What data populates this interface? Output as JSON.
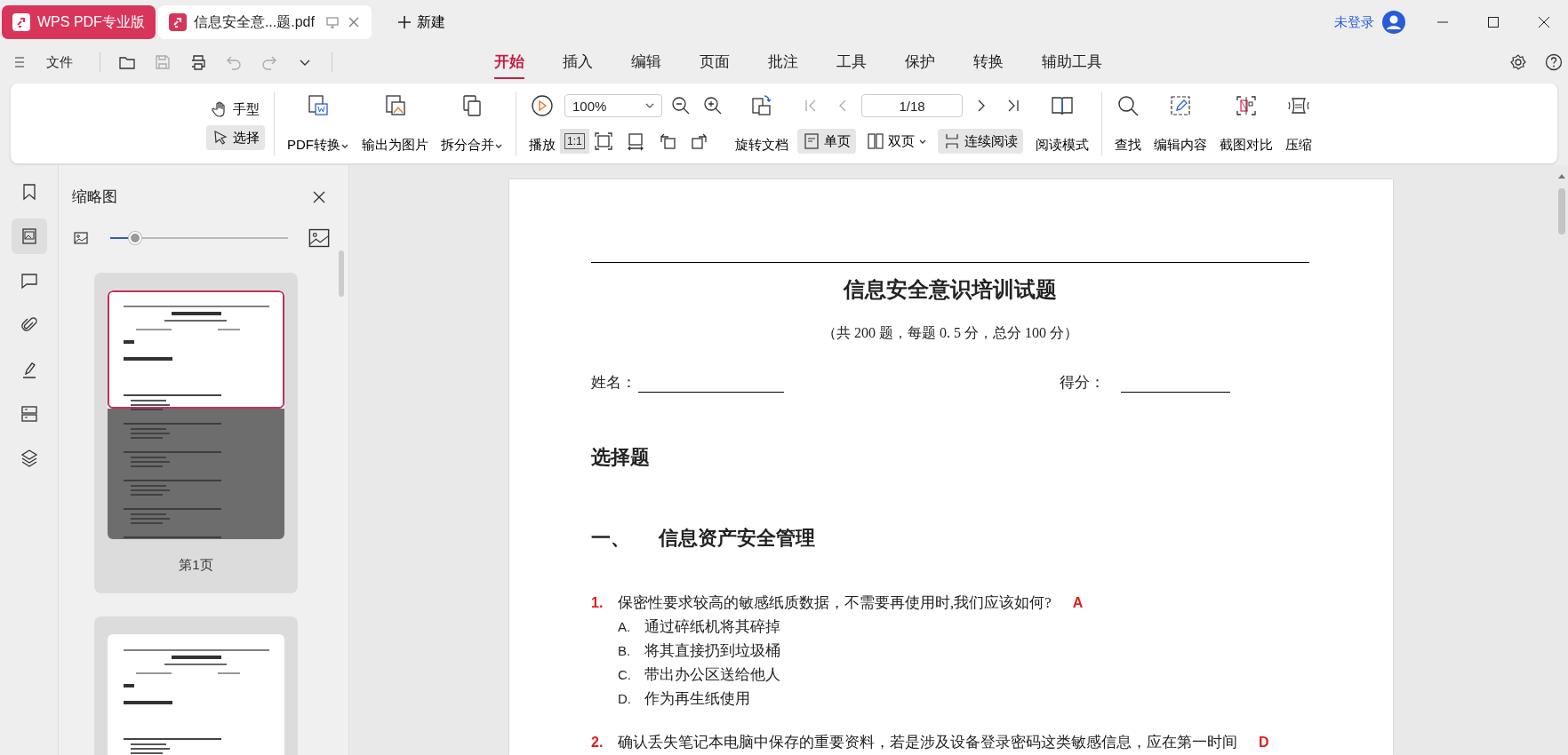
{
  "app_tabs": [
    {
      "label": "WPS PDF专业版",
      "kind": "app"
    },
    {
      "label": "信息安全意...题.pdf",
      "kind": "doc"
    }
  ],
  "new_tab": "新建",
  "account": "未登录",
  "file_menu": "文件",
  "ribbon_tabs": [
    {
      "label": "开始",
      "selected": true
    },
    {
      "label": "插入",
      "selected": false
    },
    {
      "label": "编辑",
      "selected": false
    },
    {
      "label": "页面",
      "selected": false
    },
    {
      "label": "批注",
      "selected": false
    },
    {
      "label": "工具",
      "selected": false
    },
    {
      "label": "保护",
      "selected": false
    },
    {
      "label": "转换",
      "selected": false
    },
    {
      "label": "辅助工具",
      "selected": false
    }
  ],
  "ribbon": {
    "pointer_tools": [
      {
        "label": "手型",
        "kind": "hand",
        "selected": false
      },
      {
        "label": "选择",
        "kind": "select",
        "selected": true
      }
    ],
    "convert_tools": [
      {
        "label": "PDF转换",
        "kind": "convert",
        "dropdown": true
      },
      {
        "label": "输出为图片",
        "kind": "image",
        "dropdown": false
      },
      {
        "label": "拆分合并",
        "kind": "split",
        "dropdown": true
      }
    ],
    "play": "播放",
    "zoom": {
      "value": "100%"
    },
    "actual_size": {
      "label": "1:1",
      "selected": true
    },
    "view_icons": [
      {
        "kind": "fit-page"
      },
      {
        "kind": "fit-width"
      },
      {
        "kind": "rotate-left"
      },
      {
        "kind": "rotate-right"
      }
    ],
    "rotate_doc": "旋转文档",
    "page": {
      "value": "1/18"
    },
    "layout_modes": [
      {
        "label": "单页",
        "kind": "single",
        "selected": true,
        "dropdown": false
      },
      {
        "label": "双页",
        "kind": "double",
        "selected": false,
        "dropdown": true
      },
      {
        "label": "连续阅读",
        "kind": "continuous",
        "selected": true,
        "dropdown": false
      }
    ],
    "read_mode": "阅读模式",
    "tools": [
      {
        "label": "查找",
        "kind": "search"
      },
      {
        "label": "编辑内容",
        "kind": "edit"
      },
      {
        "label": "截图对比",
        "kind": "compare"
      },
      {
        "label": "压缩",
        "kind": "compress"
      }
    ]
  },
  "side_tabs": [
    {
      "kind": "bookmark",
      "selected": false
    },
    {
      "kind": "thumbnail",
      "selected": true
    },
    {
      "kind": "comment",
      "selected": false
    },
    {
      "kind": "attachment",
      "selected": false
    },
    {
      "kind": "signature",
      "selected": false
    },
    {
      "kind": "form",
      "selected": false
    },
    {
      "kind": "layers",
      "selected": false
    }
  ],
  "thumbnails": {
    "title": "缩略图",
    "size_slider": {
      "level": 0.14
    },
    "pages": [
      {
        "label": "第1页",
        "selected": true
      },
      {
        "selected": false
      }
    ]
  },
  "document": {
    "title": "信息安全意识培训试题",
    "subtitle": "（共 200 题，每题 0. 5 分，总分 100 分）",
    "name_label": "姓名：",
    "score_label": "得分：",
    "section": "选择题",
    "heading_number": "一、",
    "heading": "信息资产安全管理",
    "questions": [
      {
        "number": "1.",
        "text": "保密性要求较高的敏感纸质数据，不需要再使用时,我们应该如何?",
        "answer": "A",
        "options": [
          {
            "letter": "A.",
            "text": "通过碎纸机将其碎掉"
          },
          {
            "letter": "B.",
            "text": "将其直接扔到垃圾桶"
          },
          {
            "letter": "C.",
            "text": "带出办公区送给他人"
          },
          {
            "letter": "D.",
            "text": "作为再生纸使用"
          }
        ]
      },
      {
        "number": "2.",
        "text": "确认丢失笔记本电脑中保存的重要资料，若是涉及设备登录密码这类敏感信息，应在第一时间",
        "answer": "D"
      }
    ]
  }
}
